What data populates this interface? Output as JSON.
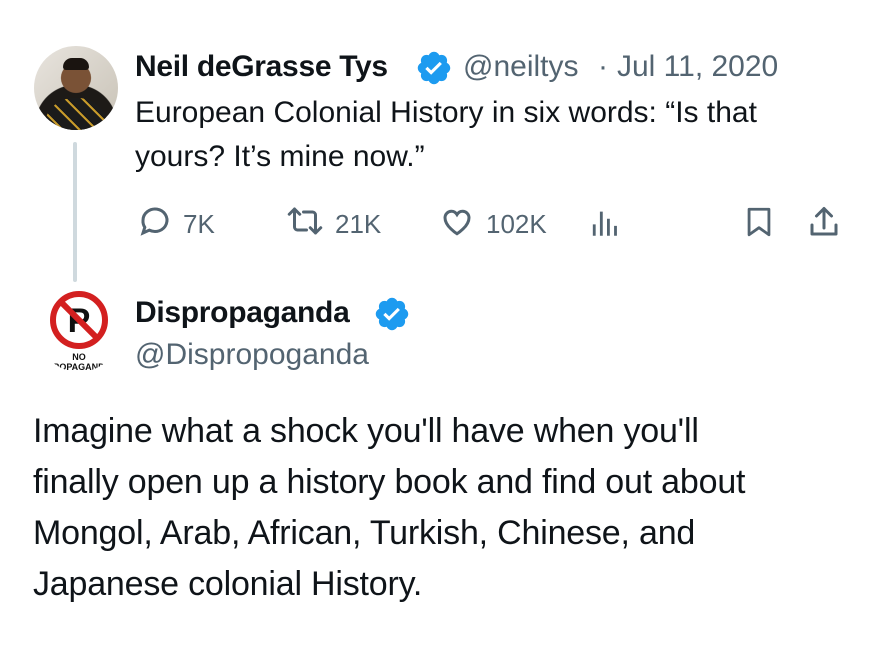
{
  "quoted_tweet": {
    "author_name": "Neil deGrasse Tys",
    "handle": "@neiltys",
    "separator": "·",
    "date": "Jul 11, 2020",
    "text": "European Colonial History in six words:  “Is that yours? It’s mine now.”",
    "text_line1": "European Colonial History in six words:  “Is that",
    "text_line2": "yours? It’s mine now.”",
    "actions": {
      "replies": "7K",
      "retweets": "21K",
      "likes": "102K"
    }
  },
  "reply_tweet": {
    "author_name": "Dispropaganda",
    "handle": "@Dispropoganda",
    "avatar_text": "NO\nPROPAGANDA",
    "text_lines": [
      "Imagine what a shock you'll have when you'll",
      "finally open up a history book and find out about",
      "Mongol, Arab, African, Turkish, Chinese, and",
      "Japanese colonial History."
    ]
  },
  "colors": {
    "verified_blue": "#1d9bf0",
    "muted": "#536471",
    "text": "#0f1419",
    "thread_line": "#cfd9de",
    "no_sign_red": "#d32020"
  },
  "icons": [
    "reply-icon",
    "retweet-icon",
    "like-icon",
    "views-icon",
    "bookmark-icon",
    "share-icon",
    "verified-badge-icon"
  ]
}
